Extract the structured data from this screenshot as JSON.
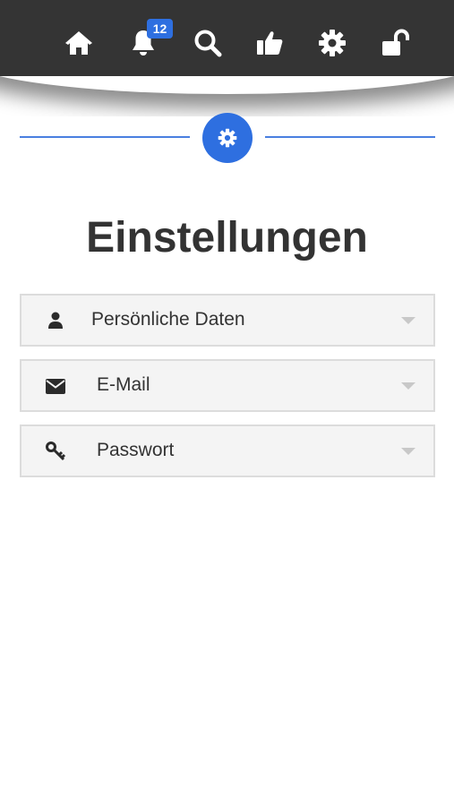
{
  "nav": {
    "items": [
      {
        "icon": "home-icon"
      },
      {
        "icon": "bell-icon",
        "badge": "12"
      },
      {
        "icon": "search-icon"
      },
      {
        "icon": "thumbs-up-icon"
      },
      {
        "icon": "gear-icon"
      },
      {
        "icon": "unlock-icon"
      }
    ]
  },
  "header": {
    "divider_icon": "gear-icon",
    "title": "Einstellungen"
  },
  "accordion": {
    "items": [
      {
        "label": "Persönliche Daten",
        "icon": "user-icon"
      },
      {
        "label": "E-Mail",
        "icon": "envelope-icon"
      },
      {
        "label": "Passwort",
        "icon": "key-icon"
      }
    ]
  },
  "colors": {
    "topbar": "#343434",
    "accent": "#2e6fe0",
    "divider": "#4a7fe0",
    "panel": "#f4f4f4"
  }
}
